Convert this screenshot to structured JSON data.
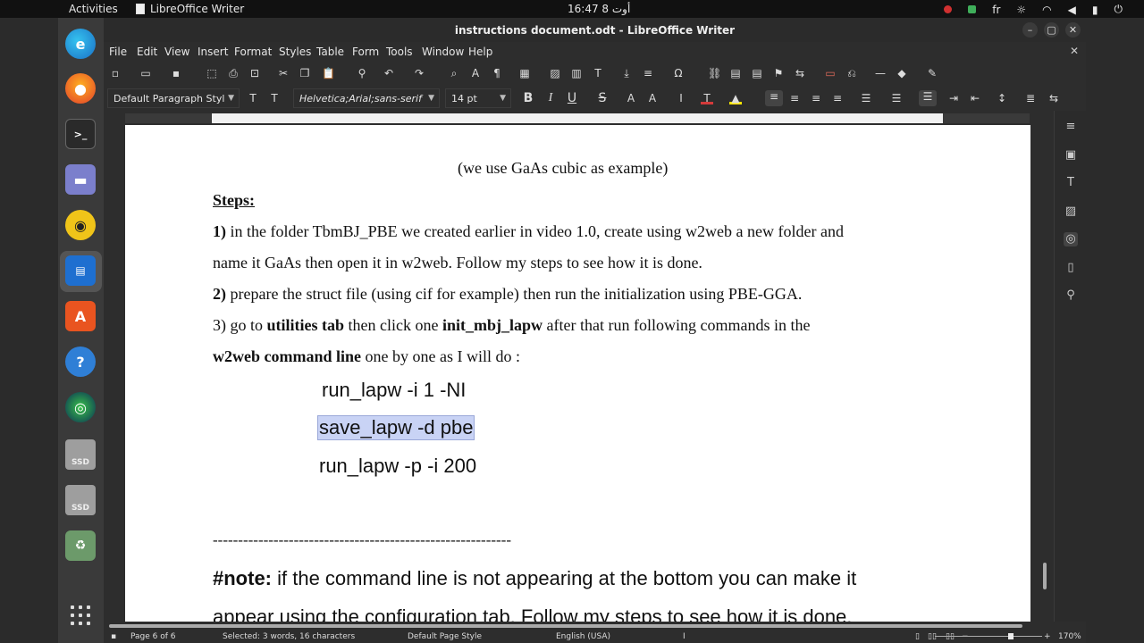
{
  "topbar": {
    "activities": "Activities",
    "app_name": "LibreOffice Writer",
    "clock": "16:47  أوت 8",
    "keyboard_layout": "fr"
  },
  "window": {
    "title": "instructions document.odt - LibreOffice Writer",
    "minimize": "–",
    "maximize": "▢",
    "close": "✕"
  },
  "menu": {
    "items": [
      "File",
      "Edit",
      "View",
      "Insert",
      "Format",
      "Styles",
      "Table",
      "Form",
      "Tools",
      "Window",
      "Help"
    ],
    "close_doc": "✕"
  },
  "formatting": {
    "paragraph_style": "Default Paragraph Styl",
    "font_name": "Helvetica;Arial;sans-serif",
    "font_size": "14 pt",
    "bold": "B",
    "italic": "I",
    "underline": "U",
    "strike": "S"
  },
  "document": {
    "line_intro": "(we use  GaAs cubic as example)",
    "steps_heading": "Steps:",
    "step1_num": "1)",
    "step1_a": " in the folder TbmBJ_PBE we created earlier in video 1.0, create using w2web a new folder and",
    "step1_b": "name it GaAs then open it in w2web. Follow my steps to see how it is done.",
    "step2_num": "2)",
    "step2": " prepare the struct file (using cif for example) then run the initialization using PBE-GGA.",
    "step3_pre": "3)  go to ",
    "step3_b1": "utilities  tab",
    "step3_mid": " then click one ",
    "step3_b2": "init_mbj_lapw",
    "step3_post": " after that run following commands in the",
    "step3_b3": "w2web command line",
    "step3_end": "  one by one as I will do :",
    "cmd1": "run_lapw -i 1 -NI",
    "cmd2": "save_lapw -d pbe",
    "cmd3": "run_lapw -p -i 200",
    "separator": "-----------------------------------------------------------",
    "note_label": "#note:",
    "note_a": " if the command line is not  appearing at the bottom you can make it",
    "note_b": "appear using the configuration tab. Follow my steps to see how it is done."
  },
  "status": {
    "page": "Page 6 of 6",
    "selection": "Selected: 3 words, 16 characters",
    "page_style": "Default Page Style",
    "language": "English (USA)",
    "zoom": "170%",
    "zoom_minus": "−",
    "zoom_plus": "+"
  }
}
